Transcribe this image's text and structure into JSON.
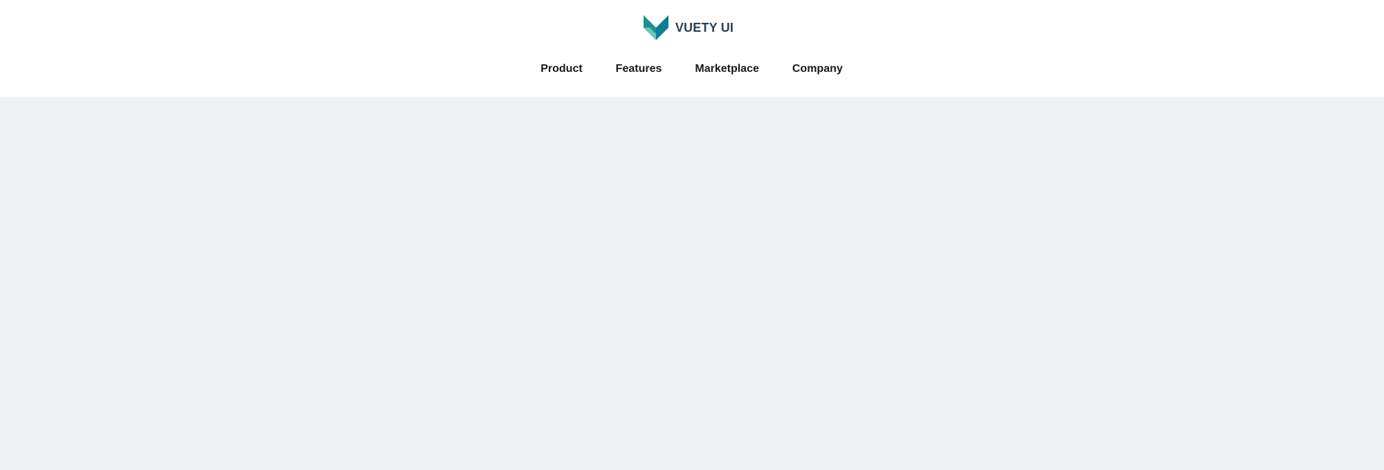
{
  "brand": {
    "name": "VUETY UI",
    "logo_icon": "vuety-chevron-logo-icon",
    "colors": {
      "logo_dark": "#0a7f95",
      "logo_mid": "#1f8f8f",
      "logo_light": "#6ec3bd",
      "text": "#274156"
    }
  },
  "nav": {
    "items": [
      {
        "label": "Product"
      },
      {
        "label": "Features"
      },
      {
        "label": "Marketplace"
      },
      {
        "label": "Company"
      }
    ]
  },
  "theme": {
    "header_bg": "#ffffff",
    "page_bg": "#eff2f5",
    "nav_text": "#161a1d"
  }
}
